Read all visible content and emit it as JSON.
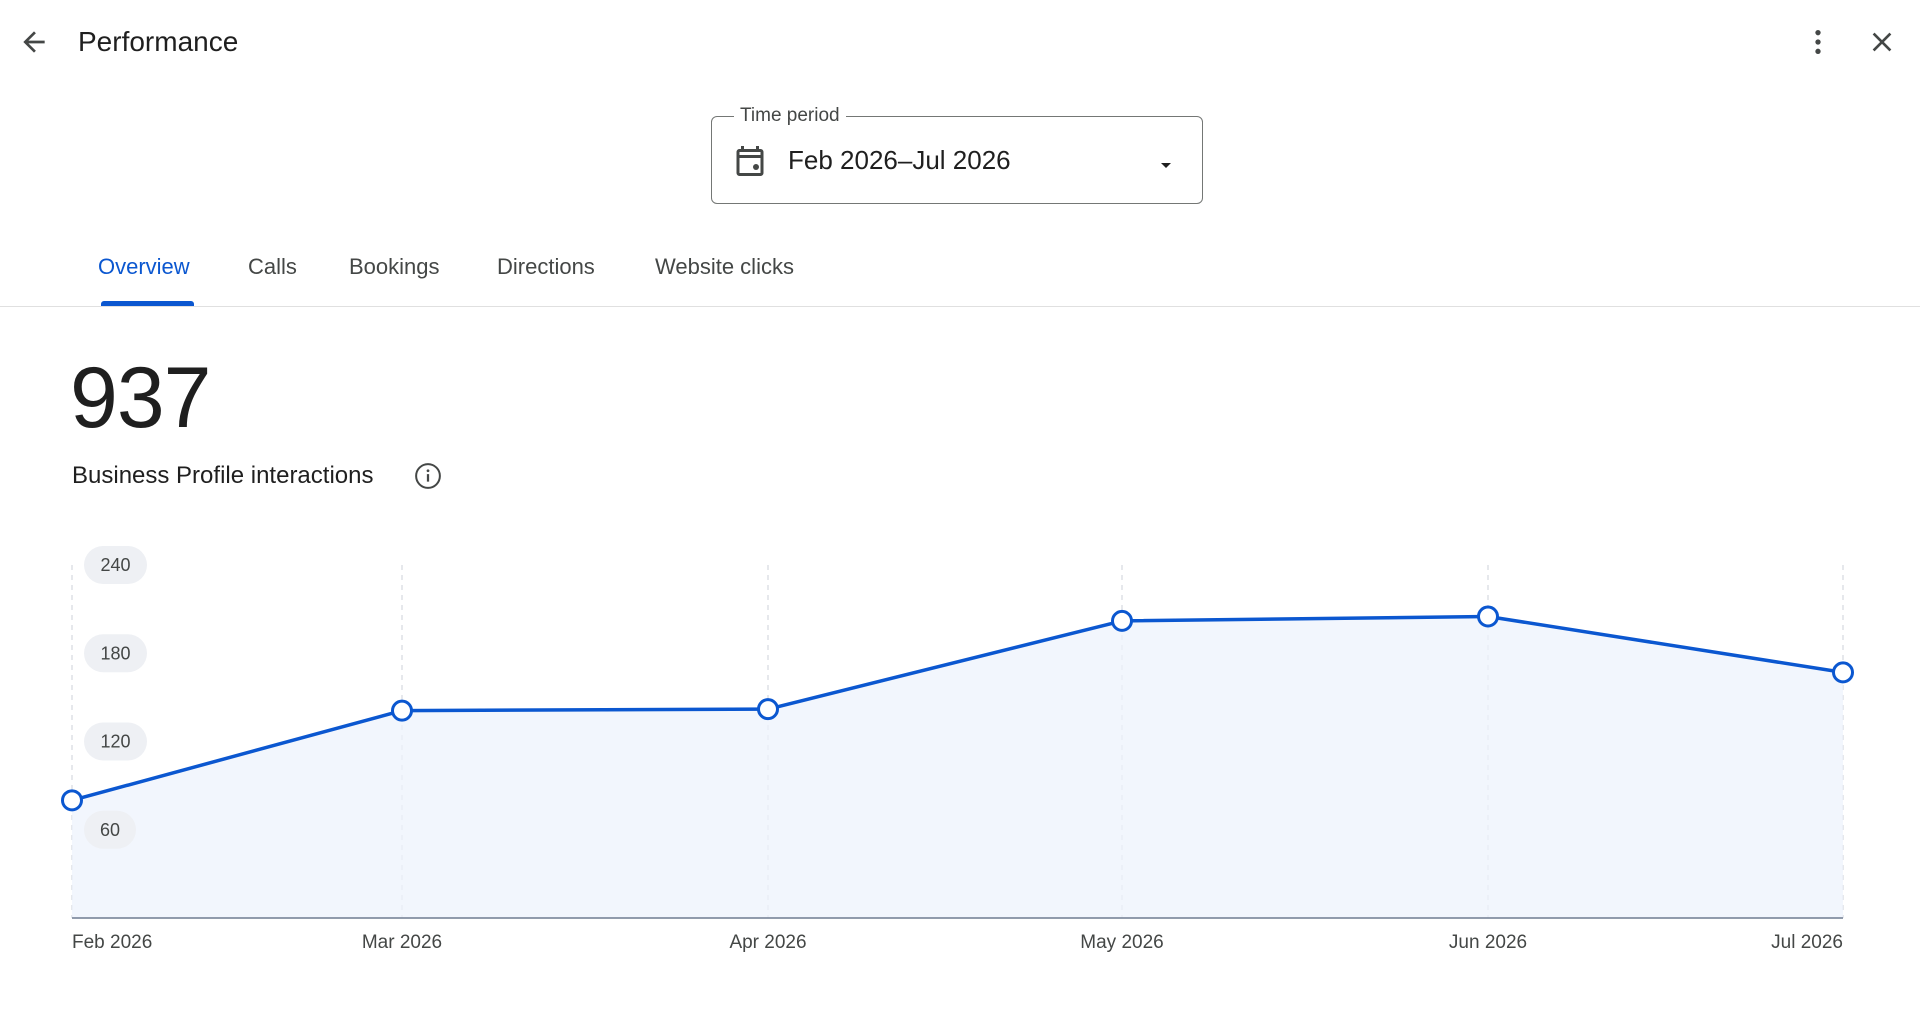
{
  "header": {
    "title": "Performance",
    "back_icon": "arrow-back-icon",
    "more_icon": "more-vert-icon",
    "close_icon": "close-icon"
  },
  "time_period": {
    "label": "Time period",
    "value": "Feb 2026–Jul 2026",
    "icon": "calendar-icon"
  },
  "tabs": [
    {
      "label": "Overview",
      "active": true
    },
    {
      "label": "Calls",
      "active": false
    },
    {
      "label": "Bookings",
      "active": false
    },
    {
      "label": "Directions",
      "active": false
    },
    {
      "label": "Website clicks",
      "active": false
    }
  ],
  "summary": {
    "total": "937",
    "label": "Business Profile interactions",
    "info_icon": "info-icon"
  },
  "colors": {
    "accent": "#0b57d0",
    "area_fill": "#eef3fc",
    "text": "#1f1f1f"
  },
  "chart_data": {
    "type": "area",
    "categories": [
      "Feb 2026",
      "Mar 2026",
      "Apr 2026",
      "May 2026",
      "Jun 2026",
      "Jul 2026"
    ],
    "series": [
      {
        "values": [
          80,
          141,
          142,
          202,
          205,
          167
        ]
      }
    ],
    "yticks": [
      60,
      120,
      180,
      240
    ],
    "ylim": [
      0,
      240
    ],
    "grid": "vertical dashed"
  }
}
